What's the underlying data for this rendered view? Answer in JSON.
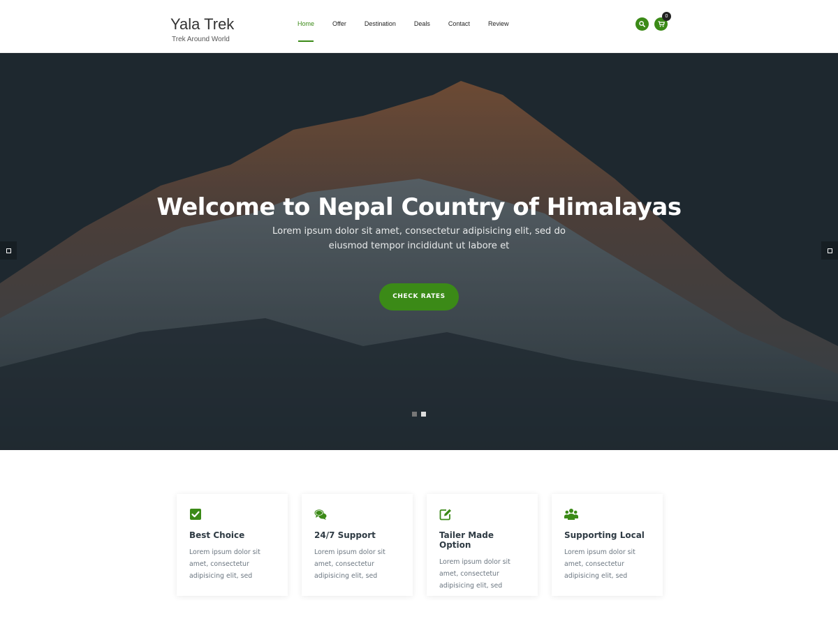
{
  "brand": {
    "title": "Yala Trek",
    "tagline": "Trek Around World"
  },
  "nav": {
    "items": [
      {
        "label": "Home",
        "active": true
      },
      {
        "label": "Offer",
        "active": false
      },
      {
        "label": "Destination",
        "active": false
      },
      {
        "label": "Deals",
        "active": false
      },
      {
        "label": "Contact",
        "active": false
      },
      {
        "label": "Review",
        "active": false
      }
    ]
  },
  "header_icons": {
    "search": "search-icon",
    "cart": "cart-icon",
    "cart_count": "0"
  },
  "hero": {
    "title": "Welcome to Nepal Country of Himalayas",
    "subtitle": "Lorem ipsum dolor sit amet, consectetur adipisicing elit, sed do eiusmod tempor incididunt ut labore et",
    "cta_label": "CHECK RATES",
    "slides_count": 2,
    "active_slide": 2
  },
  "features": [
    {
      "icon": "check-square-icon",
      "title": "Best Choice",
      "text": "Lorem ipsum dolor sit amet, consectetur adipisicing elit, sed"
    },
    {
      "icon": "comments-icon",
      "title": "24/7 Support",
      "text": "Lorem ipsum dolor sit amet, consectetur adipisicing elit, sed"
    },
    {
      "icon": "edit-icon",
      "title": "Tailer Made Option",
      "text": "Lorem ipsum dolor sit amet, consectetur adipisicing elit, sed"
    },
    {
      "icon": "users-icon",
      "title": "Supporting Local",
      "text": "Lorem ipsum dolor sit amet, consectetur adipisicing elit, sed"
    }
  ],
  "colors": {
    "accent": "#3b8a17",
    "hero_bg": "#27333a"
  }
}
